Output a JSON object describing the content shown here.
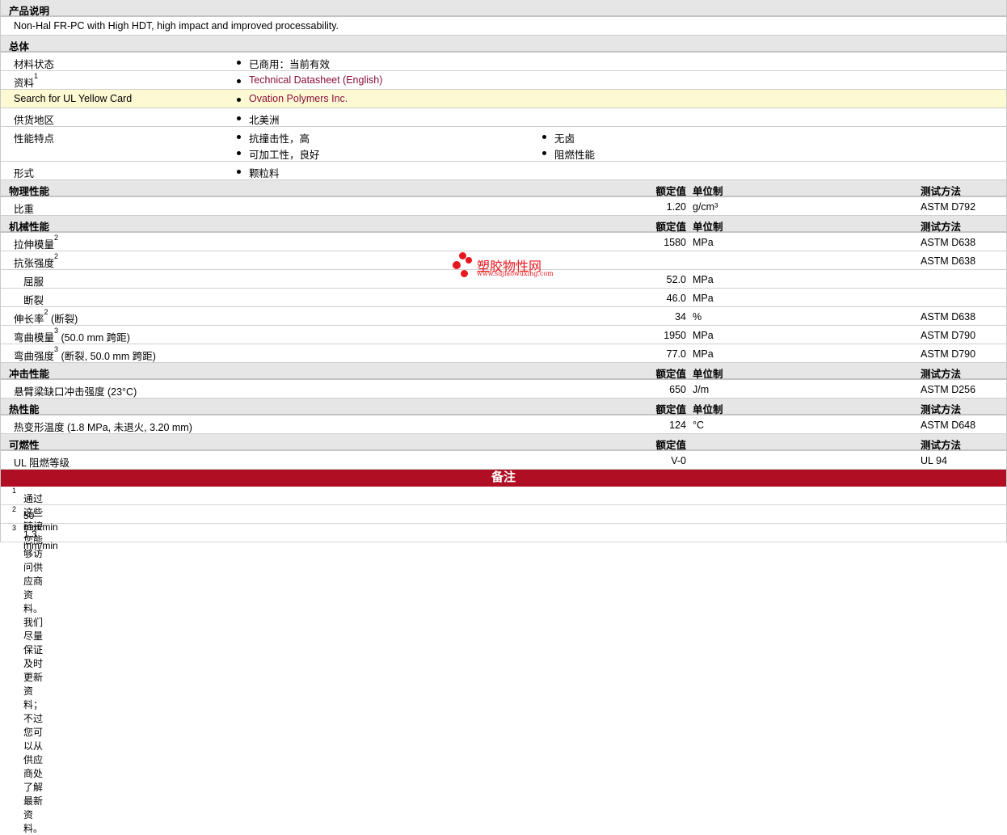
{
  "sections": [
    {
      "type": "section",
      "title": "产品说明"
    },
    {
      "type": "text",
      "text": "Non-Hal FR-PC with High HDT, high impact and improved processability."
    },
    {
      "type": "section",
      "title": "总体"
    },
    {
      "type": "general",
      "label": "材料状态",
      "items": [
        "已商用：当前有效"
      ]
    },
    {
      "type": "general",
      "label": "资料",
      "sup": "1",
      "items": [
        "Technical Datasheet (English)"
      ],
      "link": true
    },
    {
      "type": "general",
      "label": "Search for UL Yellow Card",
      "items": [
        "Ovation Polymers Inc."
      ],
      "link": true,
      "highlight": true
    },
    {
      "type": "general",
      "label": "供货地区",
      "items": [
        "北美洲"
      ]
    },
    {
      "type": "general2",
      "label": "性能特点",
      "col1": [
        "抗撞击性，高",
        "可加工性，良好"
      ],
      "col2": [
        "无卤",
        "阻燃性能"
      ]
    },
    {
      "type": "general",
      "label": "形式",
      "items": [
        "颗粒料"
      ]
    },
    {
      "type": "section",
      "title": "物理性能",
      "h_value": "额定值",
      "h_unit": "单位制",
      "h_method": "测试方法"
    },
    {
      "type": "prop",
      "label": "比重",
      "value": "1.20",
      "unit": "g/cm³",
      "method": "ASTM D792"
    },
    {
      "type": "section",
      "title": "机械性能",
      "h_value": "额定值",
      "h_unit": "单位制",
      "h_method": "测试方法"
    },
    {
      "type": "prop",
      "label": "拉伸模量",
      "sup": "2",
      "value": "1580",
      "unit": "MPa",
      "method": "ASTM D638"
    },
    {
      "type": "prop",
      "label": "抗张强度",
      "sup": "2",
      "method": "ASTM D638"
    },
    {
      "type": "prop",
      "label": "屈服",
      "subrow": true,
      "value": "52.0",
      "unit": "MPa"
    },
    {
      "type": "prop",
      "label": "断裂",
      "subrow": true,
      "value": "46.0",
      "unit": "MPa"
    },
    {
      "type": "prop",
      "label": "伸长率",
      "sup": "2",
      "suffix": "(断裂)",
      "value": "34",
      "unit": "%",
      "method": "ASTM D638"
    },
    {
      "type": "prop",
      "label": "弯曲模量",
      "sup": "3",
      "suffix": "(50.0 mm 跨距)",
      "value": "1950",
      "unit": "MPa",
      "method": "ASTM D790"
    },
    {
      "type": "prop",
      "label": "弯曲强度",
      "sup": "3",
      "suffix": "(断裂, 50.0 mm 跨距)",
      "value": "77.0",
      "unit": "MPa",
      "method": "ASTM D790"
    },
    {
      "type": "section",
      "title": "冲击性能",
      "h_value": "额定值",
      "h_unit": "单位制",
      "h_method": "测试方法"
    },
    {
      "type": "prop",
      "label": "悬臂梁缺口冲击强度 (23°C)",
      "value": "650",
      "unit": "J/m",
      "method": "ASTM D256"
    },
    {
      "type": "section",
      "title": "热性能",
      "h_value": "额定值",
      "h_unit": "单位制",
      "h_method": "测试方法"
    },
    {
      "type": "prop",
      "label": "热变形温度 (1.8 MPa, 未退火, 3.20 mm)",
      "value": "124",
      "unit": "°C",
      "method": "ASTM D648"
    },
    {
      "type": "section",
      "title": "可燃性",
      "h_value": "额定值",
      "h_method": "测试方法"
    },
    {
      "type": "prop",
      "label": "UL 阻燃等级",
      "value": "V-0",
      "method": "UL 94"
    }
  ],
  "notes": {
    "title": "备注",
    "items": [
      {
        "sup": "1",
        "text": "通过这些链接您能够访问供应商资料。我们尽量保证及时更新资料；不过您可以从供应商处了解最新资料。"
      },
      {
        "sup": "2",
        "text": "50 mm/min"
      },
      {
        "sup": "3",
        "text": "1.3 mm/min"
      }
    ]
  },
  "watermark": {
    "name": "塑胶物性网",
    "url": "www.sujiaowuxing.com"
  },
  "colors": {
    "section_bg": "#e6e6e6",
    "highlight": "#fdf9d3",
    "link": "#8a0f3c",
    "notes_header": "#b00e22"
  }
}
